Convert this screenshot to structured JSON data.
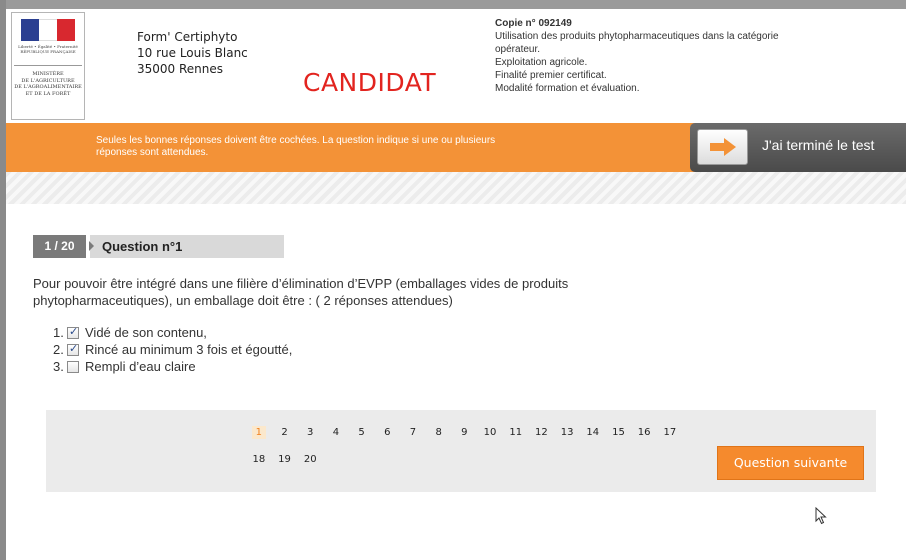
{
  "header": {
    "logo": {
      "motto": "Liberté • Égalité • Fraternité",
      "republic": "RÉPUBLIQUE FRANÇAISE",
      "ministry_lines": [
        "MINISTÈRE",
        "DE L'AGRICULTURE",
        "DE L'AGROALIMENTAIRE",
        "ET DE LA FORÊT"
      ]
    },
    "org_lines": [
      "Form' Certiphyto",
      "10 rue Louis Blanc",
      "35000 Rennes"
    ],
    "role": "CANDIDAT",
    "copy_number": "Copie n° 092149",
    "copy_details": [
      "Utilisation des produits phytopharmaceutiques dans la catégorie",
      "opérateur.",
      "Exploitation agricole.",
      "Finalité premier certificat.",
      "Modalité formation et évaluation."
    ]
  },
  "bar": {
    "instructions_line1": "Seules les bonnes réponses doivent être cochées. La question indique si une ou plusieurs",
    "instructions_line2": "réponses sont attendues.",
    "finish_label": "J'ai terminé le test"
  },
  "question": {
    "counter": "1 / 20",
    "title": "Question n°1",
    "text_line1": "Pour pouvoir être intégré dans une filière d’élimination d’EVPP (emballages vides de produits",
    "text_line2": "phytopharmaceutiques), un emballage doit être : ( 2 réponses attendues)",
    "answers": [
      {
        "num": "1.",
        "label": "Vidé de son contenu,",
        "checked": true
      },
      {
        "num": "2.",
        "label": "Rincé au minimum 3 fois et égoutté,",
        "checked": true
      },
      {
        "num": "3.",
        "label": "Rempli d’eau claire",
        "checked": false
      }
    ]
  },
  "pagination": {
    "row1": [
      "1",
      "2",
      "3",
      "4",
      "5",
      "6",
      "7",
      "8",
      "9",
      "10",
      "11",
      "12",
      "13",
      "14",
      "15",
      "16",
      "17"
    ],
    "row2": [
      "18",
      "19",
      "20"
    ],
    "current": "1",
    "next_label": "Question suivante"
  },
  "colors": {
    "accent": "#f39237",
    "candidat": "#e2241f"
  }
}
